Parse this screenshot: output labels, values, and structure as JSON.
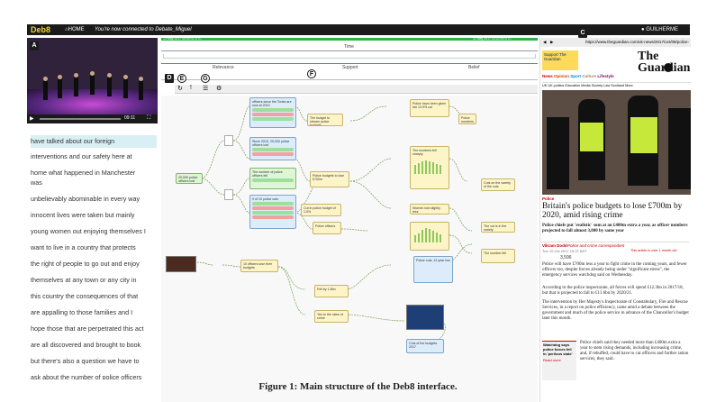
{
  "app": {
    "logo": "Deb8",
    "home": "HOME",
    "connection": "You're now connected to Debate_Miguel",
    "user": "GUILHERME"
  },
  "labels": {
    "a": "A",
    "b": "B",
    "c": "C",
    "d": "D",
    "e": "E",
    "f": "F",
    "g": "G"
  },
  "timeline": {
    "title": "Time",
    "start": "13 May 2017 00:00:11 UTC",
    "end": "11 May 2017 22:22:45 UTC"
  },
  "categories": [
    "Relevance",
    "Support",
    "Belief"
  ],
  "video": {
    "time": "09:11"
  },
  "transcript": [
    "have talked about our foreign",
    "interventions and our safety here at",
    "home what happened in Manchester",
    "was",
    "unbelievably abominable in every way",
    "innocent lives were taken but mainly",
    "young women out enjoying themselves I",
    "want to live in a country that protects",
    "the right of people to go out and enjoy",
    "themselves at any town or any city in",
    "this country the consequences of that",
    "are appalling to those families and I",
    "hope those that are perpetrated this act",
    "are all discovered and brought to book",
    "but there's also a question we have to",
    "ask about the number of police officers"
  ],
  "nodes": [
    "officers since the Tories are now at 2010",
    "The budget to stream police budgets",
    "Police have been given fair 13.9% cut",
    "20,000 police officers lost since fall 2010",
    "Since 2010, 20,000 police officers lost",
    "10 officers lose their budgets",
    "Fell by 1.8bn",
    "Police budgets to lose £700m",
    "The number of police officers fell",
    "Cut in police budget of 1.5%",
    "9 of 10 police cuts",
    "Police officers",
    "The numbers fell sharply",
    "Women lost slightly less",
    "Police cuts, 12 year low",
    "Cuts on the variety of the cuts",
    "The cut is in the variety",
    "The number fell",
    "Police numbers",
    "Yes to the rates of crime",
    "Cuts of the budgets 2017"
  ],
  "browser": {
    "url": "https://www.theguardian.com/uk-news/2017/oct/08/police-b",
    "support": "Support The Guardian",
    "brand": "The Guardian",
    "nav": [
      "News",
      "Opinion",
      "Sport",
      "Culture",
      "Lifestyle"
    ],
    "subnav": [
      "UK",
      "UK politics",
      "Education",
      "Media",
      "Society",
      "Law",
      "Scotland",
      "More"
    ],
    "section": "Police",
    "headline": "Britain's police budgets to lose £700m by 2020, amid rising crime",
    "standfirst": "Police chiefs put 'realistic' sum at an £400m extra a year, as officer numbers projected to fall almost 3,000 by same year",
    "byline": "Vikram Dodd",
    "byline_role": "Police and crime correspondent",
    "date": "Tue 10 Oct 2017 15.37 BST",
    "note": "This article is over 1 month old",
    "shares": "3,596",
    "body": [
      "Police will have £700m less a year to fight crime in the coming years, and fewer officers too, despite forces already being under \"significant stress\", the emergency services watchdog said on Wednesday.",
      "According to the police inspectorate, all forces will spend £12.3bn in 2017/18, but that is projected to fall to £11.6bn by 2020/21.",
      "The intervention by Her Majesty's Inspectorate of Constabulary, Fire and Rescue Services, in a report on police efficiency, came amid a debate between the government and much of the police service in advance of the Chancellor's budget later this month."
    ],
    "aside_title": "Watchdog says police forces fell in 'perilous state'",
    "aside_link": "Read more",
    "aside_body": "Police chiefs said they needed more than £400m extra a year to stem rising demands, including increasing crime, and, if rebuffed, could have to cut officers and further ration services, they said."
  },
  "caption": "Figure 1: Main structure of the Deb8 interface."
}
